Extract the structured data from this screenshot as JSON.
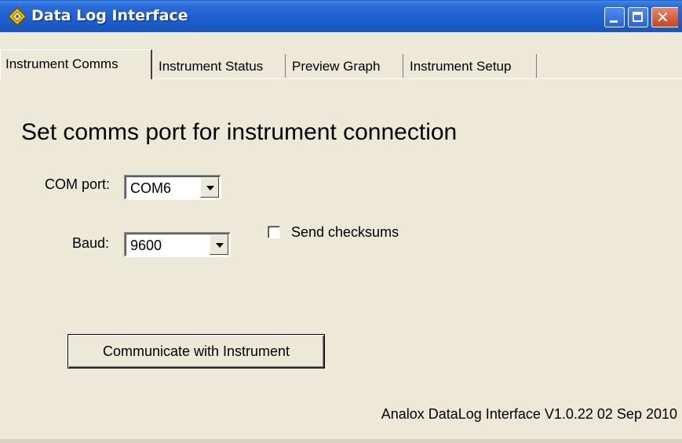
{
  "window": {
    "title": "Data Log Interface",
    "accent_color": "#1d5fd0"
  },
  "icons": {
    "app": "diamond-app-icon",
    "minimize": "minimize-icon",
    "maximize": "maximize-icon",
    "close": "close-icon",
    "dropdown": "chevron-down-icon"
  },
  "tabs": [
    {
      "label": "Instrument Comms",
      "active": true
    },
    {
      "label": "Instrument Status",
      "active": false
    },
    {
      "label": "Preview Graph",
      "active": false
    },
    {
      "label": "Instrument Setup",
      "active": false
    }
  ],
  "main": {
    "heading": "Set comms port for instrument connection",
    "com_port": {
      "label": "COM port:",
      "value": "COM6"
    },
    "baud": {
      "label": "Baud:",
      "value": "9600"
    },
    "send_checksums": {
      "label": "Send checksums",
      "checked": false
    },
    "communicate_button": "Communicate with Instrument",
    "version": "Analox DataLog Interface V1.0.22 02 Sep 2010"
  }
}
